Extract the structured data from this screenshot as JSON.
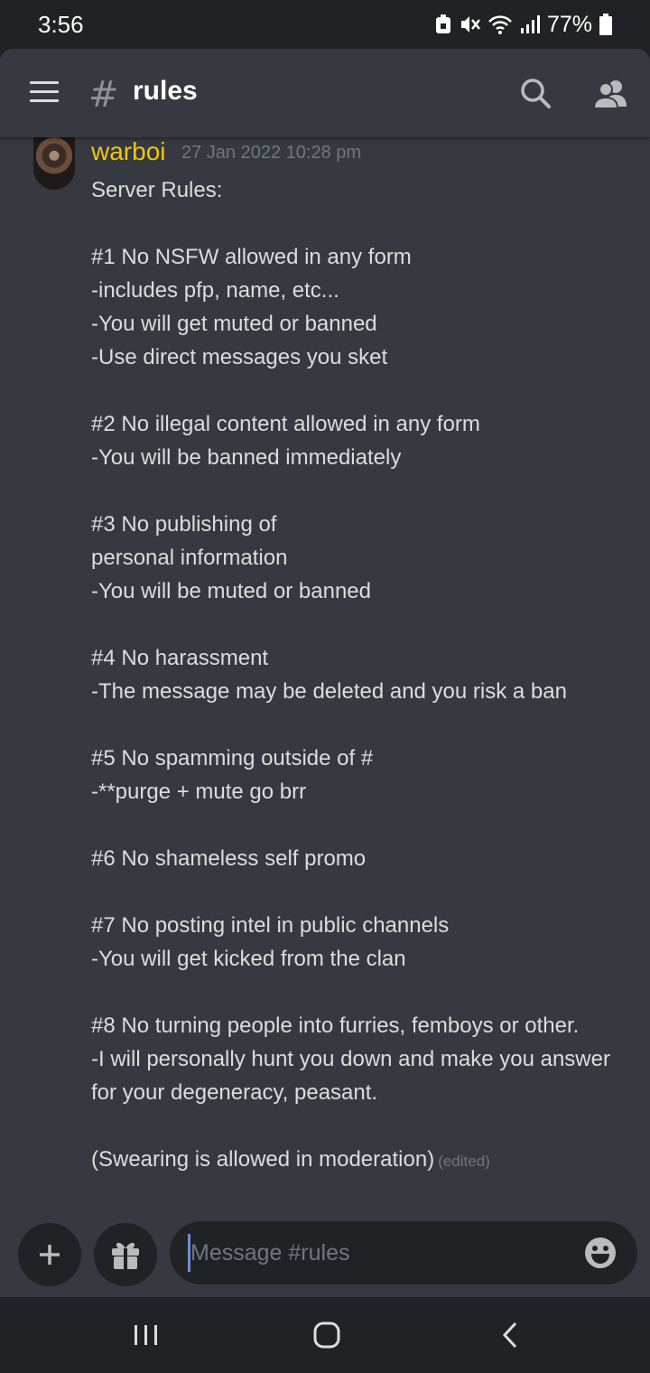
{
  "status_bar": {
    "time": "3:56",
    "battery_percent": "77%",
    "icons": [
      "sim-lock-icon",
      "mute-icon",
      "wifi-icon",
      "signal-icon",
      "battery-icon"
    ]
  },
  "header": {
    "channel_name": "rules",
    "icons": [
      "menu-icon",
      "hash-icon",
      "search-icon",
      "members-icon"
    ]
  },
  "message": {
    "author": "warboi",
    "author_color": "#f1c40f",
    "timestamp": "27 Jan 2022 10:28 pm",
    "lines": [
      "Server Rules:",
      "",
      "#1 No NSFW allowed in any form",
      "-includes pfp, name, etc...",
      "-You will get muted or banned",
      "-Use direct messages you sket",
      "",
      "#2 No illegal content allowed in any form",
      "-You will be banned immediately",
      "",
      "#3 No publishing of",
      "personal information",
      "-You will be muted or banned",
      "",
      "#4 No harassment",
      "-The message may be deleted and you risk a ban",
      "",
      "#5 No spamming outside of #",
      "-**purge + mute go brr",
      "",
      "#6 No shameless self promo",
      "",
      "#7 No posting intel in public channels",
      "-You will get kicked from the clan",
      "",
      "#8 No turning people into furries, femboys or other.",
      "-I will personally hunt you down and make you answer",
      "for your degeneracy, peasant.",
      "",
      "(Swearing is allowed in moderation)"
    ],
    "edited_label": "(edited)"
  },
  "composer": {
    "placeholder": "Message #rules",
    "value": "",
    "icons": [
      "plus-icon",
      "gift-icon",
      "emoji-icon"
    ]
  },
  "nav_bar": {
    "icons": [
      "recents-icon",
      "home-icon",
      "back-icon"
    ]
  },
  "colors": {
    "background": "#36393f",
    "dark": "#202225",
    "text": "#dcddde",
    "muted": "#72767d",
    "accent": "#7289da"
  }
}
